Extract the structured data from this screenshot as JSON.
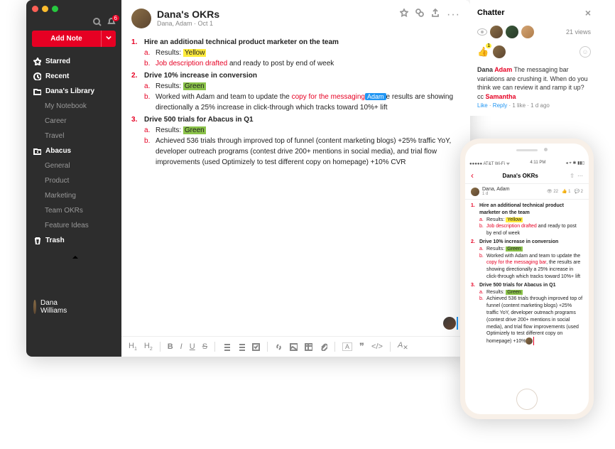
{
  "sidebar": {
    "badge": "6",
    "add_note": "Add Note",
    "items": [
      {
        "label": "Starred",
        "icon": "star",
        "strong": true
      },
      {
        "label": "Recent",
        "icon": "clock",
        "strong": true
      },
      {
        "label": "Dana's Library",
        "icon": "folder",
        "strong": true
      },
      {
        "label": "My Notebook",
        "sub": true
      },
      {
        "label": "Career",
        "sub": true
      },
      {
        "label": "Travel",
        "sub": true
      },
      {
        "label": "Abacus",
        "icon": "folder-plus",
        "strong": true
      },
      {
        "label": "General",
        "sub": true
      },
      {
        "label": "Product",
        "sub": true
      },
      {
        "label": "Marketing",
        "sub": true
      },
      {
        "label": "Team OKRs",
        "sub": true
      },
      {
        "label": "Feature Ideas",
        "sub": true
      },
      {
        "label": "Trash",
        "icon": "trash",
        "strong": true
      }
    ],
    "user": "Dana Williams"
  },
  "doc": {
    "title": "Dana's OKRs",
    "meta": "Dana, Adam · Oct 1",
    "items": [
      {
        "heading": "Hire an additional technical product marketer on the team",
        "sub": [
          {
            "prefix": "Results: ",
            "highlight": "Yellow",
            "hl_class": "hl-y"
          },
          {
            "red": "Job description drafted",
            "rest": " and ready to post by end of week"
          }
        ]
      },
      {
        "heading": "Drive 10% increase in conversion",
        "sub": [
          {
            "prefix": "Results: ",
            "highlight": "Green",
            "hl_class": "hl-g"
          },
          {
            "plain_pre": "Worked with Adam and team to update the ",
            "red": "copy for the messaging",
            "mention": "Adam",
            "rest": "e results are showing directionally a 25% increase in click-through which tracks toward 10%+ lift"
          }
        ]
      },
      {
        "heading": "Drive 500 trials for Abacus in Q1",
        "sub": [
          {
            "prefix": "Results: ",
            "highlight": "Green",
            "hl_class": "hl-g"
          },
          {
            "plain": "Achieved 536 trials through improved top of funnel (content marketing blogs) +25% traffic YoY,  developer outreach programs (contest drive 200+ mentions in social media), and trial flow improvements (used Optimizely to test different copy on homepage) +10% CVR"
          }
        ]
      }
    ]
  },
  "chatter": {
    "title": "Chatter",
    "views": "21 views",
    "reaction_count": "1",
    "comment": {
      "author_1": "Dana ",
      "author_2": "Adam",
      "text": " The messaging bar variations are crushing it. When do you think we can review it and ramp it up? cc ",
      "cc": "Samantha"
    },
    "actions": {
      "like": "Like",
      "reply": "Reply",
      "meta": "1 like · 1 d ago"
    }
  },
  "phone": {
    "carrier": "AT&T Wi-Fi",
    "time": "4:11 PM",
    "title": "Dana's OKRs",
    "meta_name": "Dana, Adam",
    "meta_time": "1 d",
    "stats": {
      "views": "22",
      "likes": "1",
      "comments": "2"
    },
    "doc_2b": ", the results are showing directionally a 25% increase in click-through which tracks toward 10%+ lift",
    "doc_3b": "Achieved 536 trials through improved top of funnel (content marketing blogs) +25% traffic YoY,  developer outreach programs (contest drive 200+ mentions in social media), and trial flow improvements (used Optimizely to test different copy on homepage) +10%"
  }
}
